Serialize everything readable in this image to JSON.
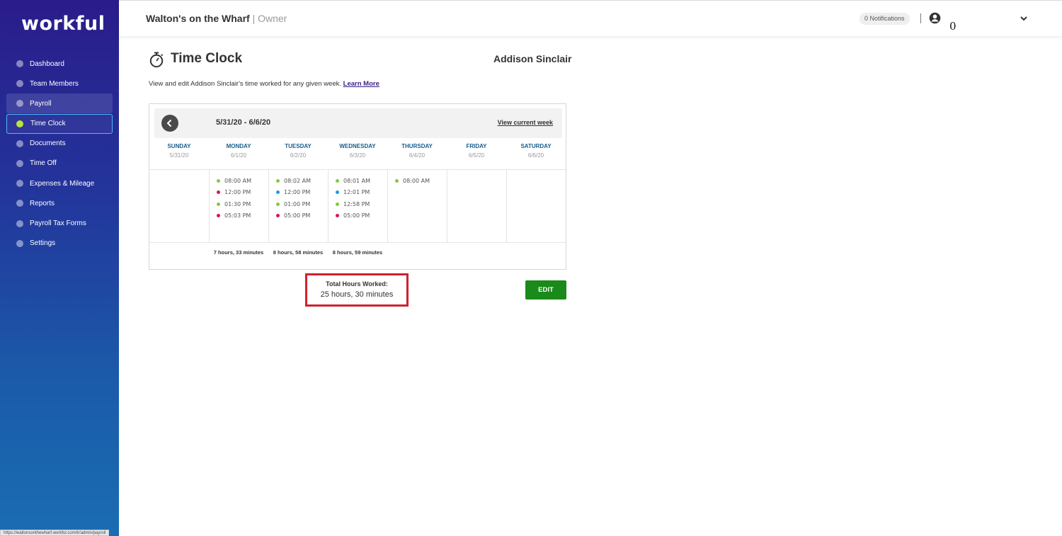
{
  "brand": {
    "logo": "workful"
  },
  "sidebar": {
    "items": [
      {
        "label": "Dashboard"
      },
      {
        "label": "Team Members"
      },
      {
        "label": "Payroll"
      },
      {
        "label": "Time Clock"
      },
      {
        "label": "Documents"
      },
      {
        "label": "Time Off"
      },
      {
        "label": "Expenses & Mileage"
      },
      {
        "label": "Reports"
      },
      {
        "label": "Payroll Tax Forms"
      },
      {
        "label": "Settings"
      }
    ],
    "active": "Time Clock",
    "hovered": "Payroll"
  },
  "topbar": {
    "company": "Walton's on the Wharf",
    "role": "| Owner",
    "notifications": "0 Notifications",
    "user_text": "0"
  },
  "page": {
    "title": "Time Clock",
    "employee": "Addison Sinclair",
    "description": "View and edit Addison Sinclair's time worked for any given week.",
    "learn_more": "Learn More"
  },
  "week": {
    "range": "5/31/20 - 6/6/20",
    "view_current": "View current week",
    "days": [
      {
        "name": "SUNDAY",
        "date": "5/31/20",
        "punches": [],
        "hours": ""
      },
      {
        "name": "MONDAY",
        "date": "6/1/20",
        "punches": [
          {
            "time": "08:00 AM",
            "type": "in"
          },
          {
            "time": "12:00 PM",
            "type": "out"
          },
          {
            "time": "01:30 PM",
            "type": "in"
          },
          {
            "time": "05:03 PM",
            "type": "out"
          }
        ],
        "hours": "7 hours, 33 minutes"
      },
      {
        "name": "TUESDAY",
        "date": "6/2/20",
        "punches": [
          {
            "time": "08:02 AM",
            "type": "in"
          },
          {
            "time": "12:00 PM",
            "type": "break"
          },
          {
            "time": "01:00 PM",
            "type": "in"
          },
          {
            "time": "05:00 PM",
            "type": "out"
          }
        ],
        "hours": "8 hours, 58 minutes"
      },
      {
        "name": "WEDNESDAY",
        "date": "6/3/20",
        "punches": [
          {
            "time": "08:01 AM",
            "type": "in"
          },
          {
            "time": "12:01 PM",
            "type": "break"
          },
          {
            "time": "12:58 PM",
            "type": "in"
          },
          {
            "time": "05:00 PM",
            "type": "out"
          }
        ],
        "hours": "8 hours, 59 minutes"
      },
      {
        "name": "THURSDAY",
        "date": "6/4/20",
        "punches": [
          {
            "time": "08:00 AM",
            "type": "in"
          }
        ],
        "hours": ""
      },
      {
        "name": "FRIDAY",
        "date": "6/5/20",
        "punches": [],
        "hours": ""
      },
      {
        "name": "SATURDAY",
        "date": "6/6/20",
        "punches": [],
        "hours": ""
      }
    ]
  },
  "total": {
    "label": "Total Hours Worked:",
    "value": "25 hours, 30 minutes"
  },
  "actions": {
    "edit": "EDIT"
  },
  "status_url": "https://waltonsonthewharf.workful.com/tr/admin/payroll",
  "colors": {
    "punch_in": "#8cc63f",
    "punch_out": "#d6184f",
    "punch_break": "#1e9bd7",
    "edit_button": "#1a8a1a",
    "highlight_box": "#d0202f"
  }
}
